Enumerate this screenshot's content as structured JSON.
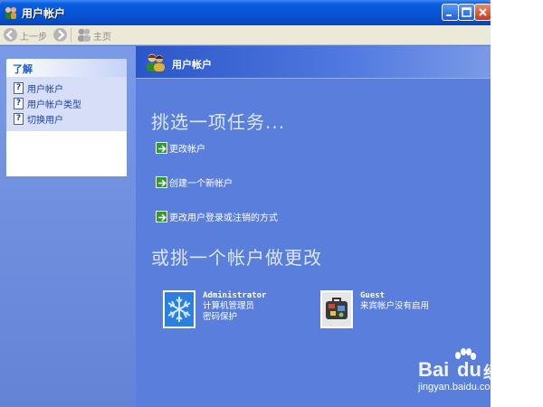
{
  "window": {
    "title": "用户帐户",
    "controls": {
      "minimize": "minimize",
      "maximize": "maximize",
      "close": "close"
    }
  },
  "toolbar": {
    "back_label": "上一步",
    "home_label": "主页"
  },
  "sidebar": {
    "learn_title": "了解",
    "items": [
      {
        "label": "用户帐户"
      },
      {
        "label": "用户帐户类型"
      },
      {
        "label": "切换用户"
      }
    ]
  },
  "main": {
    "header_title": "用户帐户",
    "task_heading": "挑选一项任务...",
    "tasks": [
      {
        "label": "更改帐户"
      },
      {
        "label": "创建一个新帐户"
      },
      {
        "label": "更改用户登录或注销的方式"
      }
    ],
    "pick_heading": "或挑一个帐户做更改",
    "accounts": [
      {
        "name": "Administrator",
        "line1": "计算机管理员",
        "line2": "密码保护",
        "icon": "snowflake-icon"
      },
      {
        "name": "Guest",
        "line1": "来宾帐户没有启用",
        "line2": "",
        "icon": "suitcase-icon"
      }
    ]
  },
  "watermark": {
    "brand": "Bai",
    "brand_suffix": "du",
    "cn": "经验",
    "url": "jingyan.baidu.com"
  },
  "colors": {
    "title_bar": "#0853d4",
    "panel": "#5a7edc",
    "task_arrow": "#2d9b2d"
  }
}
